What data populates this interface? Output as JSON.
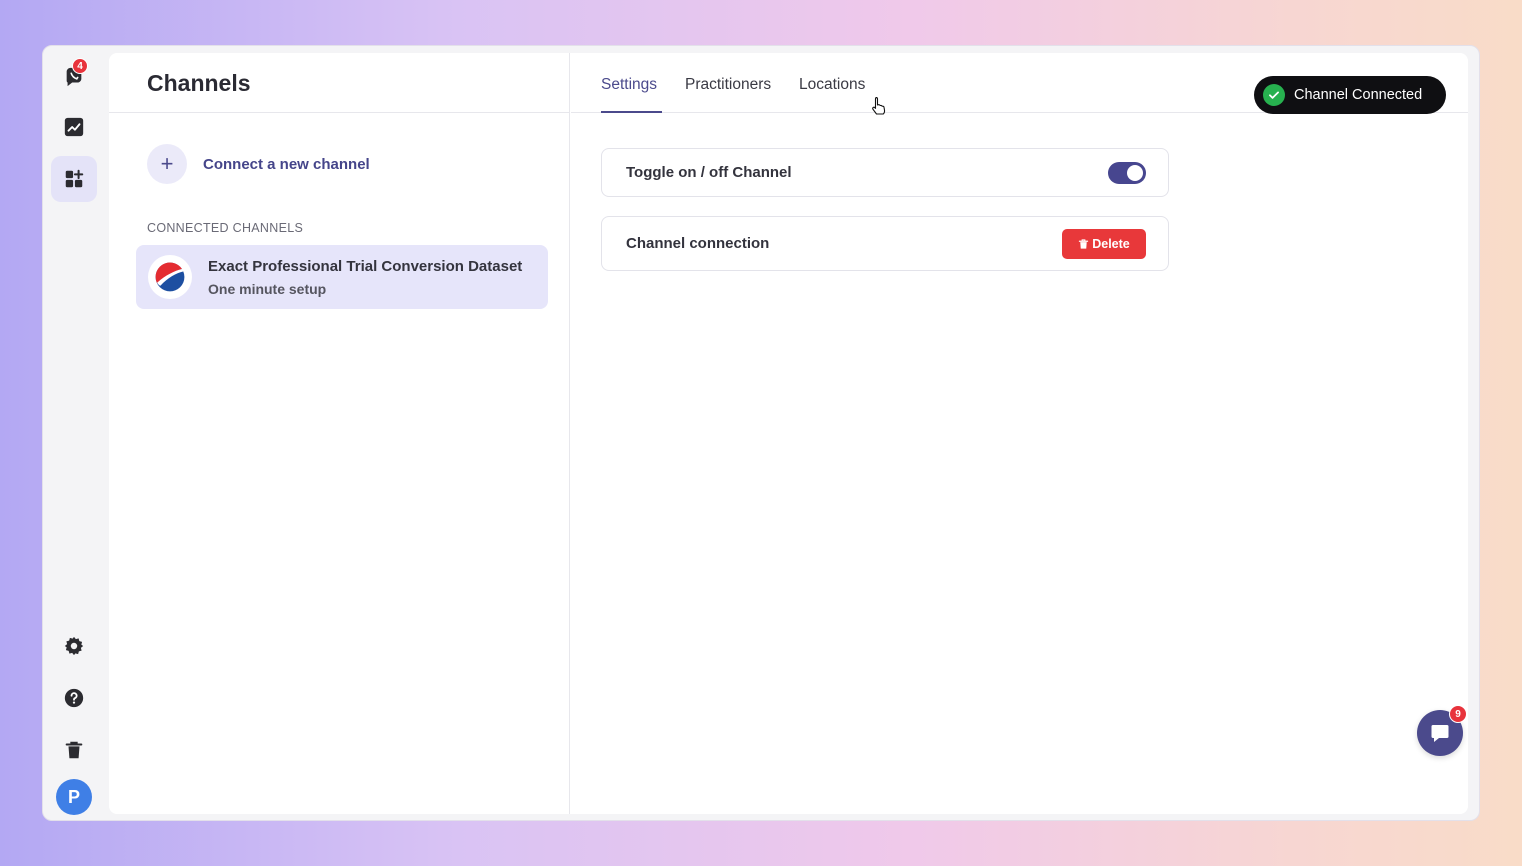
{
  "app": {
    "logo_icon": "chat-logo-icon",
    "logo_badge": "4",
    "accent_color": "#4b4a8c"
  },
  "rail": {
    "items": [
      {
        "name": "analytics",
        "icon": "trend-chart-icon"
      },
      {
        "name": "apps",
        "icon": "apps-add-icon",
        "active": true
      },
      {
        "name": "settings",
        "icon": "gear-icon"
      },
      {
        "name": "help",
        "icon": "help-icon"
      },
      {
        "name": "trash",
        "icon": "trash-icon"
      }
    ],
    "avatar_initial": "P"
  },
  "left": {
    "title": "Channels",
    "connect_label": "Connect a new channel",
    "section_label": "CONNECTED CHANNELS",
    "channels": [
      {
        "name": "Exact Professional Trial Conversion Dataset",
        "subtitle": "One minute setup",
        "icon": "pepsi-logo-icon"
      }
    ]
  },
  "tabs": [
    {
      "label": "Settings",
      "active": true
    },
    {
      "label": "Practitioners"
    },
    {
      "label": "Locations"
    }
  ],
  "toast": {
    "text": "Channel Connected",
    "color": "#27b14f"
  },
  "settings": {
    "toggle_label": "Toggle on / off Channel",
    "toggle_on": true,
    "connection_label": "Channel connection",
    "delete_label": "Delete",
    "delete_color": "#e8383a"
  },
  "chat": {
    "badge": "9",
    "icon": "chat-bubble-icon"
  }
}
